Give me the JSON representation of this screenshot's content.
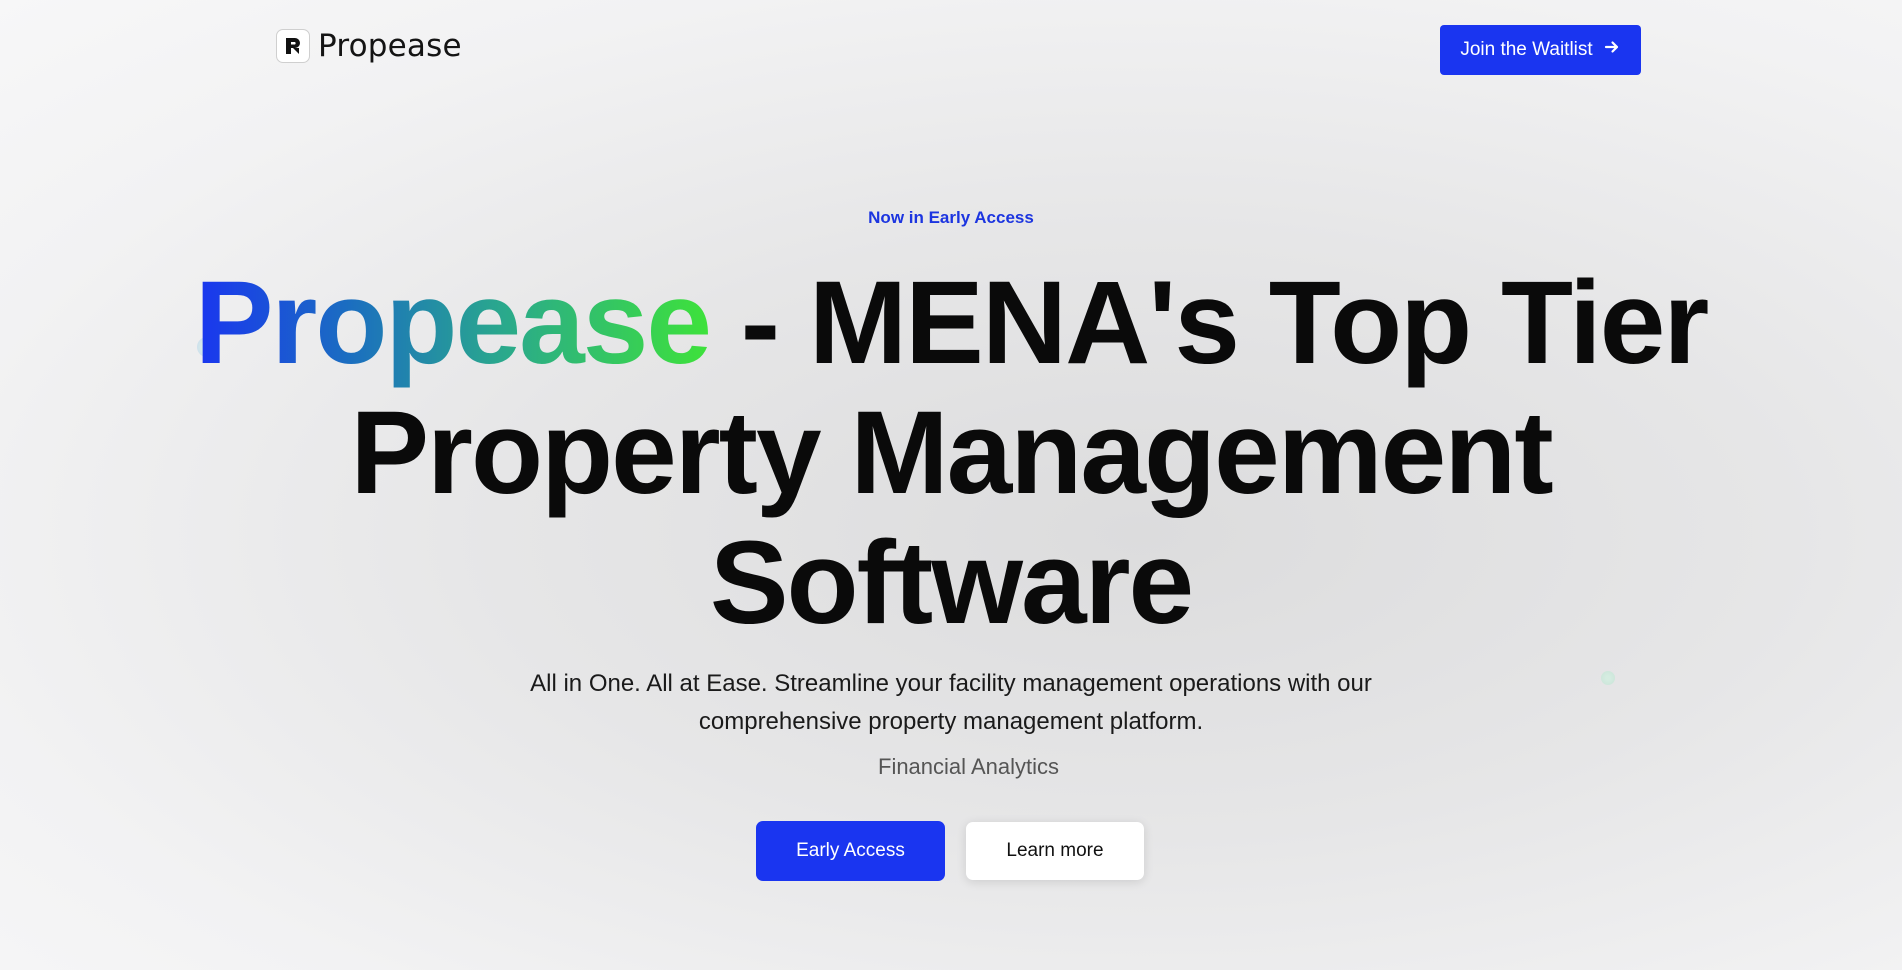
{
  "header": {
    "logo_text": "Propease",
    "cta_label": "Join the Waitlist",
    "cta_icon": "arrow-right-icon"
  },
  "hero": {
    "eyebrow": "Now in Early Access",
    "title_brand": "Propease",
    "title_line1_rest": " - MENA's Top Tier",
    "title_line2": "Property Management",
    "title_line3": "Software",
    "subtitle_line1": "All in One. All at Ease. Streamline your facility management operations with our",
    "subtitle_line2": "comprehensive property management platform.",
    "rotating_feature": "Financial Analytics",
    "primary_button": "Early Access",
    "secondary_button": "Learn more"
  },
  "colors": {
    "accent": "#1a35f0",
    "gradient_start": "#1a35f0",
    "gradient_end": "#3ee23a",
    "text": "#0a0a0a"
  }
}
